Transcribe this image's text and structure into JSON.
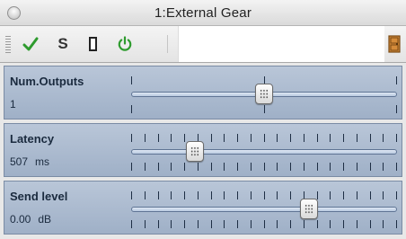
{
  "window": {
    "title": "1:External Gear"
  },
  "toolbar": {
    "buttons": [
      {
        "name": "apply",
        "icon": "checkmark-icon",
        "color": "#2e9b2e"
      },
      {
        "name": "solo",
        "label": "S"
      },
      {
        "name": "window",
        "icon": "rectangle-icon"
      },
      {
        "name": "power",
        "icon": "power-icon",
        "color": "#2e9b2e"
      },
      {
        "name": "open",
        "icon": "door-icon",
        "color": "#c87b2a"
      }
    ],
    "s_label": "S"
  },
  "parameters": [
    {
      "name": "Num.Outputs",
      "value": "1",
      "unit": "",
      "level": 0.5,
      "ticks": "sparse"
    },
    {
      "name": "Latency",
      "value": "507",
      "unit": "ms",
      "level": 0.24,
      "ticks": "dense"
    },
    {
      "name": "Send level",
      "value": "0.00",
      "unit": "dB",
      "level": 0.67,
      "ticks": "dense"
    }
  ],
  "colors": {
    "panel": "#aebcd0",
    "accent": "#2e9b2e"
  }
}
